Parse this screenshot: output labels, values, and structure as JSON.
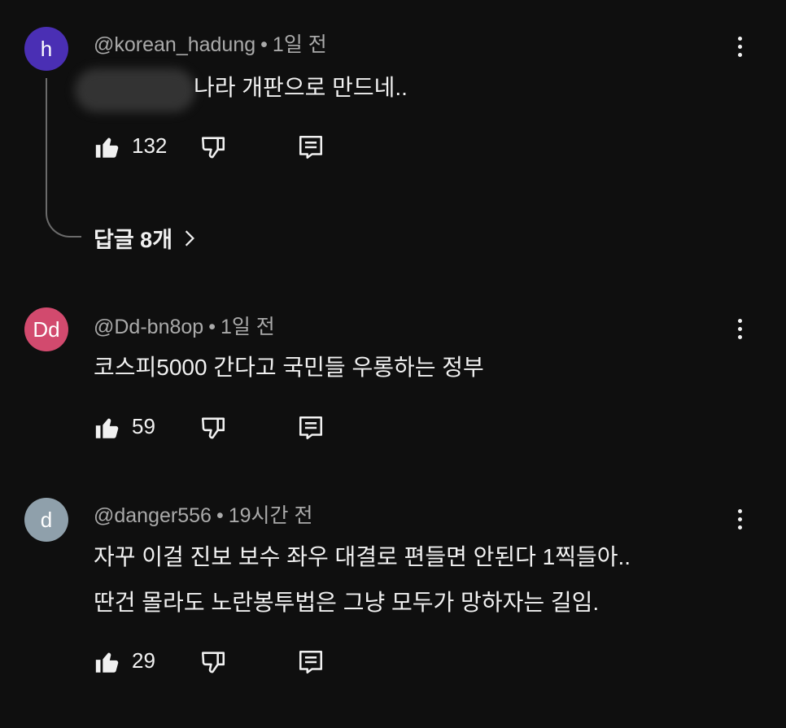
{
  "comments": [
    {
      "avatar_letter": "h",
      "avatar_color": "#4a2fb4",
      "handle": "@korean_hadung",
      "time": "1일 전",
      "text_lines": [
        "나라 개판으로 만드네.."
      ],
      "likes": "132",
      "replies_label": "답글 8개"
    },
    {
      "avatar_letter": "Dd",
      "avatar_color": "#d24a6e",
      "handle": "@Dd-bn8op",
      "time": "1일 전",
      "text_lines": [
        "코스피5000 간다고 국민들 우롱하는 정부"
      ],
      "likes": "59"
    },
    {
      "avatar_letter": "d",
      "avatar_color": "#8fa0ab",
      "handle": "@danger556",
      "time": "19시간 전",
      "text_lines": [
        "자꾸 이걸 진보 보수 좌우 대결로 편들면 안된다 1찍들아..",
        "딴건 몰라도 노란봉투법은 그냥 모두가 망하자는 길임."
      ],
      "likes": "29"
    }
  ],
  "icons": {
    "like": "thumb-up-icon",
    "dislike": "thumb-down-icon",
    "reply": "reply-icon",
    "more": "more-vert-icon",
    "chevron": "chevron-right-icon"
  }
}
